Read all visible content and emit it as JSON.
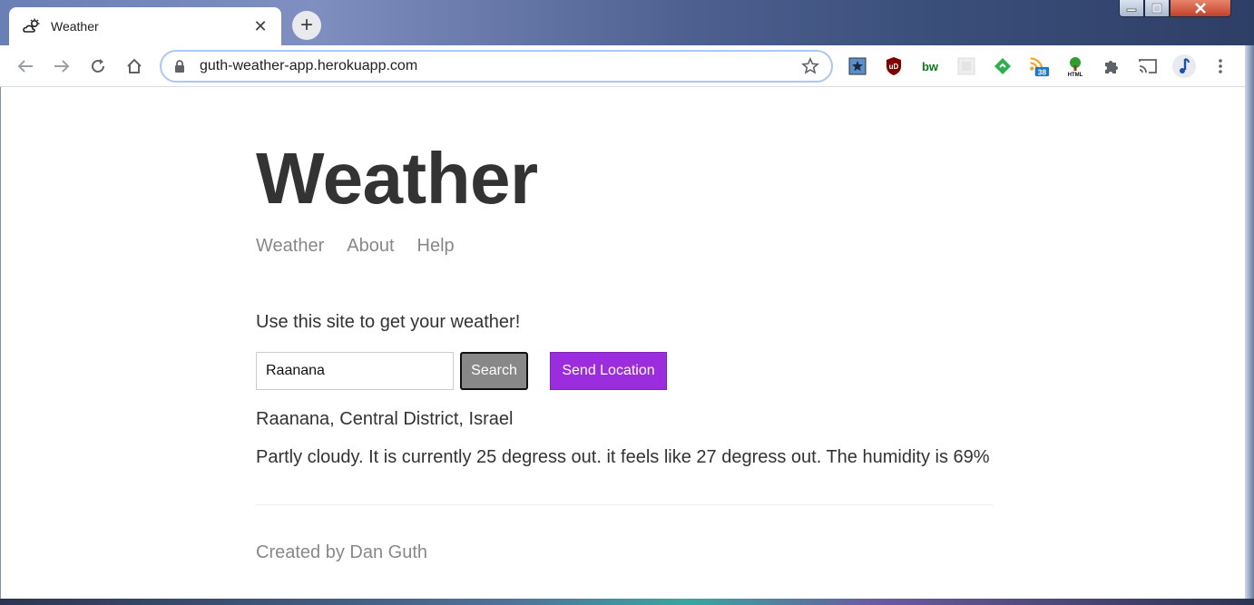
{
  "browser": {
    "tab_title": "Weather",
    "url": "guth-weather-app.herokuapp.com",
    "extensions": [
      {
        "name": "bookmark-extension-icon"
      },
      {
        "name": "ublock-icon",
        "label": "uD"
      },
      {
        "name": "bw-extension-icon",
        "label": "bw"
      },
      {
        "name": "grey-extension-icon"
      },
      {
        "name": "feedly-icon"
      },
      {
        "name": "rss-feed-icon",
        "badge": "38"
      },
      {
        "name": "html-tree-icon",
        "label": "HTML"
      },
      {
        "name": "extensions-puzzle-icon"
      },
      {
        "name": "cast-icon"
      },
      {
        "name": "profile-avatar"
      },
      {
        "name": "menu-dots-icon"
      }
    ]
  },
  "page": {
    "title": "Weather",
    "nav": [
      "Weather",
      "About",
      "Help"
    ],
    "intro": "Use this site to get your weather!",
    "search": {
      "value": "Raanana",
      "button_label": "Search"
    },
    "send_location_label": "Send Location",
    "location": "Raanana, Central District, Israel",
    "forecast": "Partly cloudy. It is currently 25 degress out. it feels like 27 degress out. The humidity is 69%",
    "footer": "Created by Dan Guth"
  },
  "colors": {
    "accent_purple": "#9b2ddf",
    "search_button_bg": "#888888",
    "heading_text": "#333333",
    "nav_text": "#888888"
  }
}
